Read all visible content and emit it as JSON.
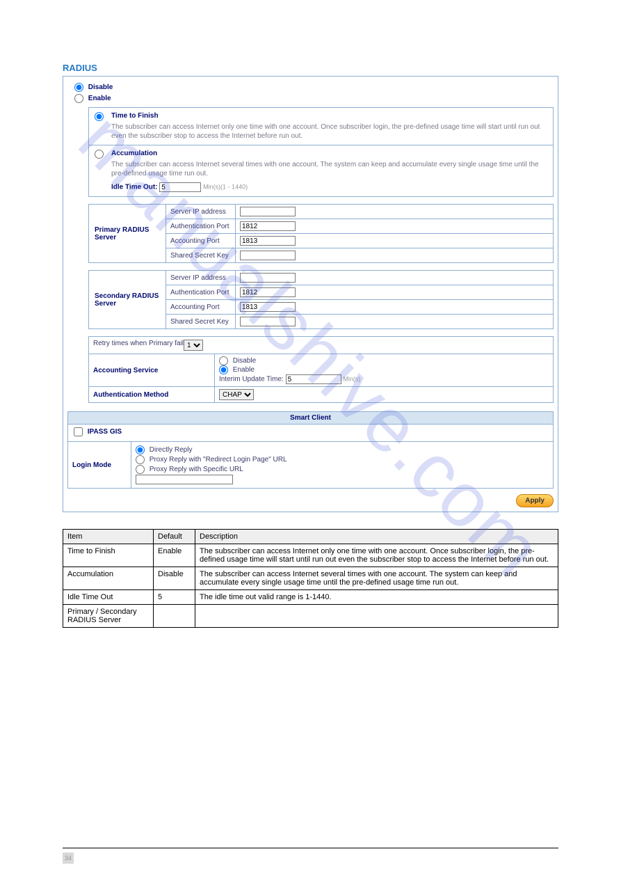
{
  "watermark_text": "manualshive.com",
  "page_title": "RADIUS",
  "radio_disable_label": "Disable",
  "radio_enable_label": "Enable",
  "mode": {
    "ttf": {
      "title": "Time to Finish",
      "desc": "The subscriber can access Internet only one time with one account.  Once subscriber login, the pre-defined usage time will start until run out even the subscriber stop to access the Internet before run out."
    },
    "acc": {
      "title": "Accumulation",
      "desc": "The subscriber can access Internet several times with one account.  The system can keep and accumulate every single usage time until the pre-defined usage time run out.",
      "idle_label": "Idle Time Out:",
      "idle_value": "5",
      "idle_note": "Min(s)(1 - 1440)"
    }
  },
  "primary_title": "Primary RADIUS Server",
  "secondary_title": "Secondary RADIUS Server",
  "srow": {
    "ip": "Server IP address",
    "auth": "Authentication Port",
    "acct": "Accounting Port",
    "secret": "Shared Secret Key"
  },
  "primary_auth_value": "1812",
  "primary_acct_value": "1813",
  "secondary_auth_value": "1812",
  "secondary_acct_value": "1813",
  "opts": {
    "retry_label": "Retry times when Primary fail",
    "retry_value": "1",
    "acct_service_label": "Accounting Service",
    "acct_disable": "Disable",
    "acct_enable": "Enable",
    "interim_label": "Interim Update Time:",
    "interim_value": "5",
    "interim_unit": "Min(s)",
    "authmethod_label": "Authentication Method",
    "authmethod_value": "CHAP"
  },
  "smart": {
    "header": "Smart Client",
    "ipass_label": "IPASS GIS",
    "login_mode_label": "Login Mode",
    "opt1": "Directly Reply",
    "opt2": "Proxy Reply with \"Redirect Login Page\" URL",
    "opt3": "Proxy Reply with Specific URL"
  },
  "apply_label": "Apply",
  "param_table": {
    "h1": "Item",
    "h2": "Default",
    "h3": "Description",
    "rows": [
      {
        "item": "Time to Finish",
        "default": "Enable",
        "desc": "The subscriber can access Internet only one time with one account. Once subscriber login, the pre-defined usage time will start until run out even the subscriber stop to access the Internet before run out."
      },
      {
        "item": "Accumulation",
        "default": "Disable",
        "desc": "The subscriber can access Internet several times with one account. The system can keep and accumulate every single usage time until the pre-defined usage time run out."
      },
      {
        "item": "Idle Time Out",
        "default": "5",
        "desc": "The idle time out valid range is 1-1440."
      },
      {
        "item": "Primary / Secondary RADIUS Server",
        "default": "",
        "desc": ""
      }
    ]
  },
  "pagenum": "34"
}
